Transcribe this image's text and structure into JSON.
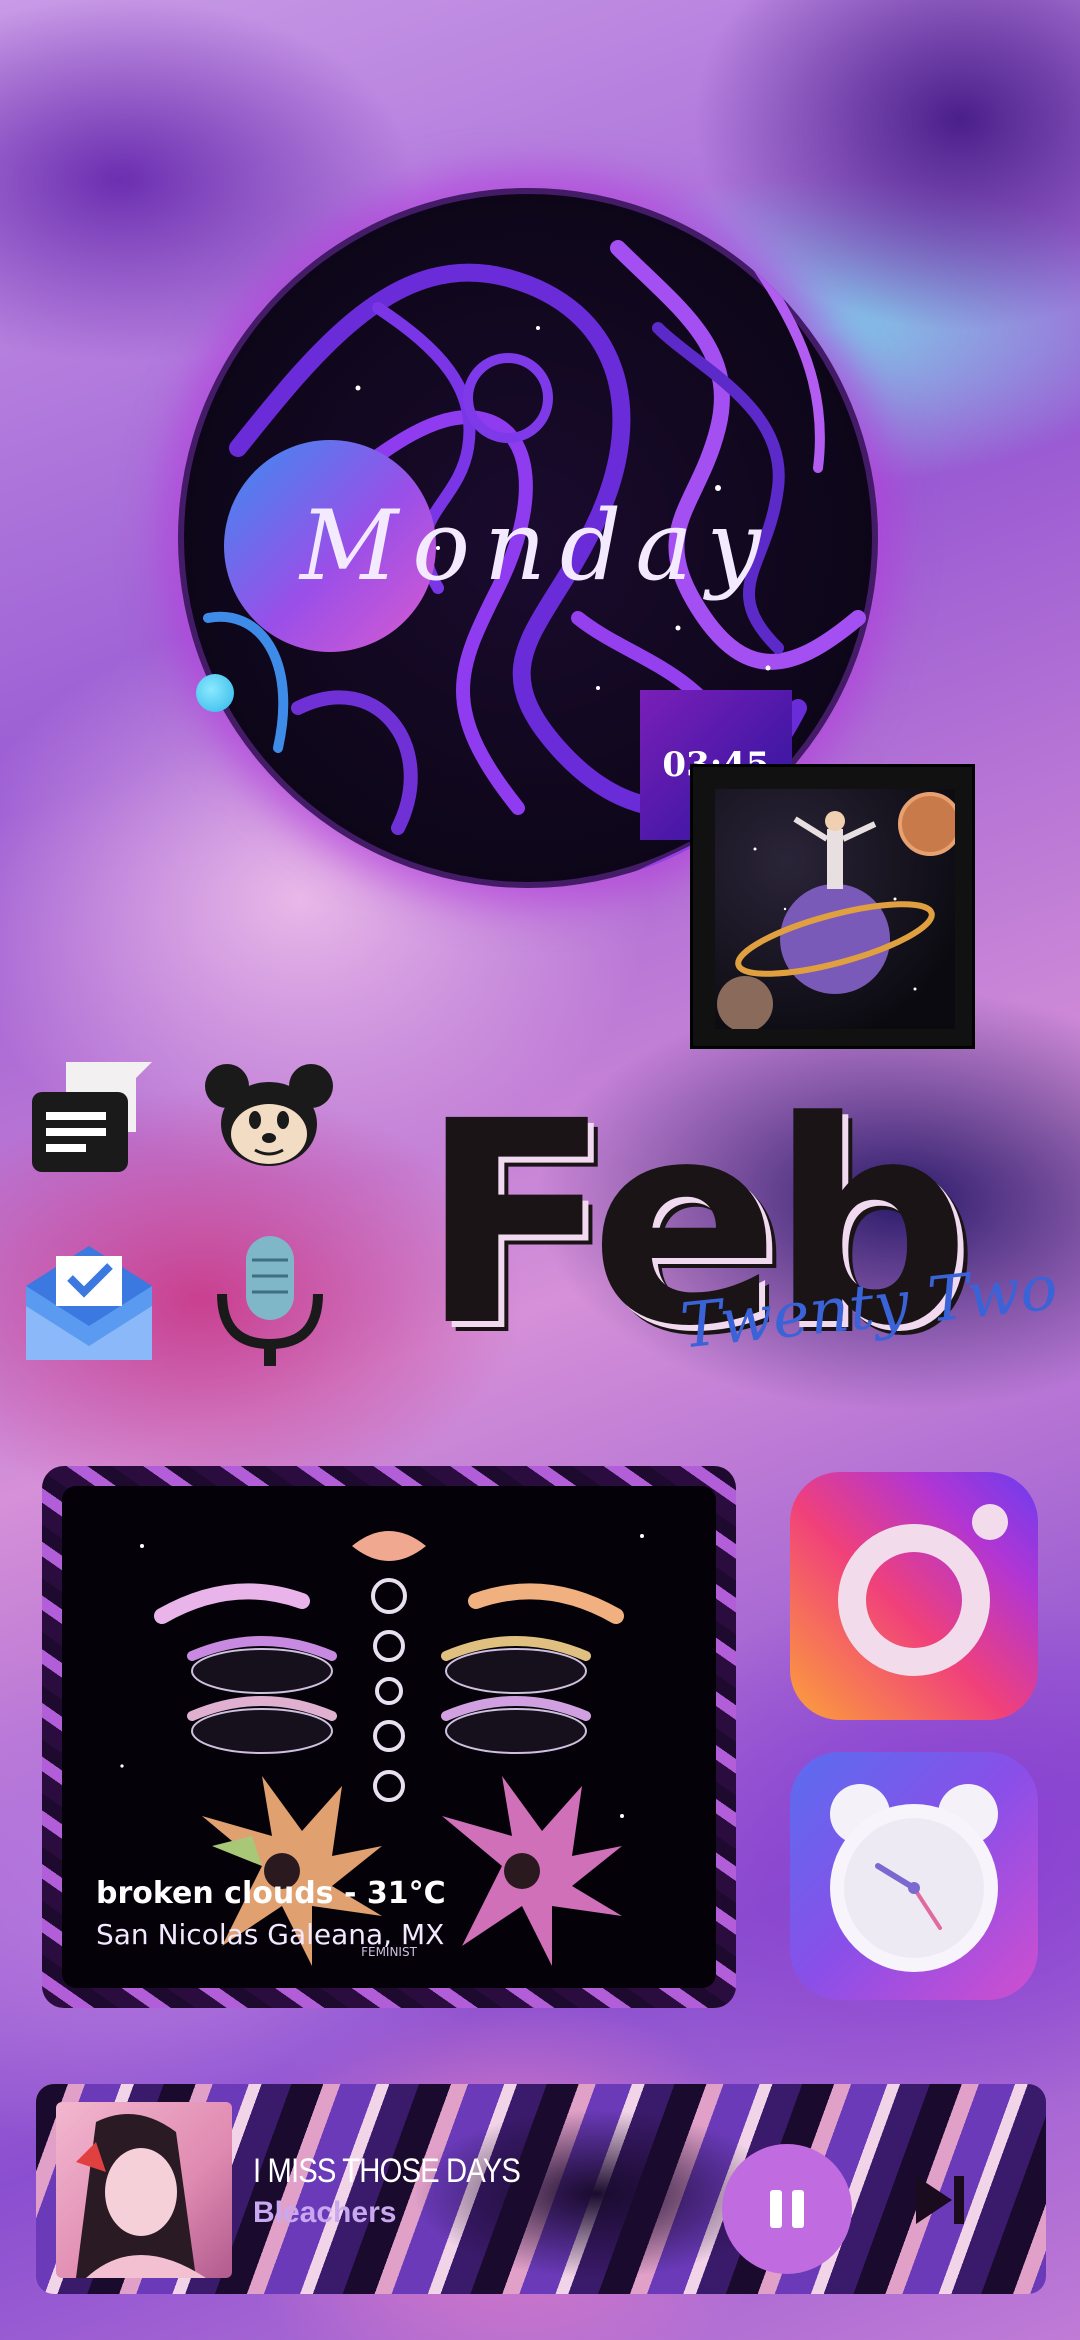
{
  "clock_widget": {
    "day": "Monday",
    "time": "03:45"
  },
  "date_widget": {
    "month": "Feb",
    "day_script": "Twenty Two"
  },
  "apps": {
    "left_icons": [
      "messaging-icon",
      "mickey-icon",
      "inbox-icon",
      "voice-recorder-icon"
    ],
    "right_icons": [
      "instagram-icon",
      "alarm-clock-icon"
    ]
  },
  "weather_widget": {
    "description": "broken clouds - 31°C",
    "location": "San Nicolas Galeana, MX",
    "artwork_caption": "FEMINIST"
  },
  "music_player": {
    "title": "I MISS THOSE DAYS",
    "artist": "Bleachers",
    "pause_icon": "pause-icon",
    "next_icon": "skip-next-icon"
  },
  "colors": {
    "accent_purple": "#9a4fe8",
    "accent_pink": "#d85bd0",
    "accent_blue": "#3a8df0"
  }
}
